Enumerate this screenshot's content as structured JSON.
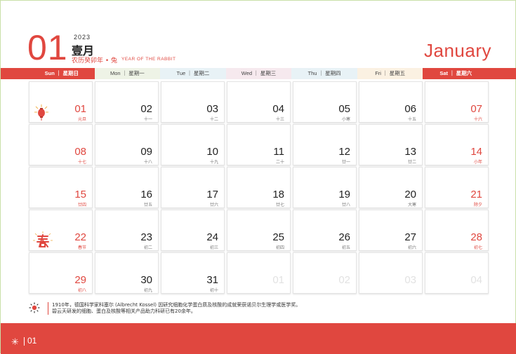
{
  "header": {
    "month_number": "01",
    "year": "2023",
    "month_cn": "壹月",
    "lunar_year": "农历癸卯年 • 兔",
    "rabbit_text": "YEAR OF THE RABBIT",
    "month_en": "January"
  },
  "weekdays": [
    {
      "label": "Sun ｜ 星期日",
      "weekend": true,
      "color": "#e0473f"
    },
    {
      "label": "Mon ｜ 星期一",
      "weekend": false,
      "color": "#eef3e6"
    },
    {
      "label": "Tue ｜ 星期二",
      "weekend": false,
      "color": "#e8f2f6"
    },
    {
      "label": "Wed ｜ 星期三",
      "weekend": false,
      "color": "#f6e9ee"
    },
    {
      "label": "Thu ｜ 星期四",
      "weekend": false,
      "color": "#e8f2f6"
    },
    {
      "label": "Fri ｜ 星期五",
      "weekend": false,
      "color": "#fbf1e2"
    },
    {
      "label": "Sat ｜ 星期六",
      "weekend": true,
      "color": "#e0473f"
    }
  ],
  "days": [
    {
      "num": "01",
      "sub": "元旦",
      "weekend": true,
      "icon": "lantern"
    },
    {
      "num": "02",
      "sub": "十一"
    },
    {
      "num": "03",
      "sub": "十二"
    },
    {
      "num": "04",
      "sub": "十三"
    },
    {
      "num": "05",
      "sub": "小寒"
    },
    {
      "num": "06",
      "sub": "十五"
    },
    {
      "num": "07",
      "sub": "十六",
      "weekend": true
    },
    {
      "num": "08",
      "sub": "十七",
      "weekend": true
    },
    {
      "num": "09",
      "sub": "十八"
    },
    {
      "num": "10",
      "sub": "十九"
    },
    {
      "num": "11",
      "sub": "二十"
    },
    {
      "num": "12",
      "sub": "廿一"
    },
    {
      "num": "13",
      "sub": "廿二"
    },
    {
      "num": "14",
      "sub": "小年",
      "weekend": true
    },
    {
      "num": "15",
      "sub": "廿四",
      "weekend": true
    },
    {
      "num": "16",
      "sub": "廿五"
    },
    {
      "num": "17",
      "sub": "廿六"
    },
    {
      "num": "18",
      "sub": "廿七"
    },
    {
      "num": "19",
      "sub": "廿八"
    },
    {
      "num": "20",
      "sub": "大寒"
    },
    {
      "num": "21",
      "sub": "除夕",
      "weekend": true
    },
    {
      "num": "22",
      "sub": "春节",
      "weekend": true,
      "icon": "spring"
    },
    {
      "num": "23",
      "sub": "初二"
    },
    {
      "num": "24",
      "sub": "初三"
    },
    {
      "num": "25",
      "sub": "初四"
    },
    {
      "num": "26",
      "sub": "初五"
    },
    {
      "num": "27",
      "sub": "初六"
    },
    {
      "num": "28",
      "sub": "初七",
      "weekend": true
    },
    {
      "num": "29",
      "sub": "初八",
      "weekend": true
    },
    {
      "num": "30",
      "sub": "初九"
    },
    {
      "num": "31",
      "sub": "初十"
    },
    {
      "num": "01",
      "sub": "",
      "faded": true
    },
    {
      "num": "02",
      "sub": "",
      "faded": true
    },
    {
      "num": "03",
      "sub": "",
      "faded": true
    },
    {
      "num": "04",
      "sub": "",
      "faded": true,
      "weekend": true
    }
  ],
  "footnote": {
    "line1": "1910年，德国科学家科塞尔 (Albrecht Kossel) 因研究细胞化学蛋白质及核酸的成就荣获诺贝尔生理学或医学奖。",
    "line2": "碧云天研发的细胞、蛋白及核酸等相关产品助力科研已有20余年。",
    "icon": "sun-icon"
  },
  "page_number": "01",
  "colors": {
    "accent": "#e0473f",
    "border": "#c9dfa8"
  }
}
